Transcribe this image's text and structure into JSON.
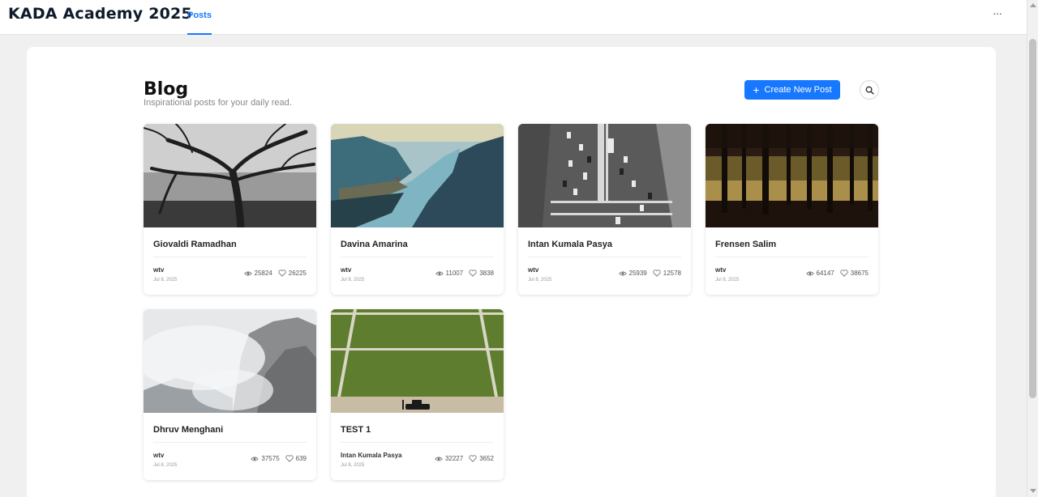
{
  "header": {
    "brand": "KADA Academy 2025",
    "tab_posts": "Posts",
    "more": "···"
  },
  "page": {
    "title": "Blog",
    "subtitle": "Inspirational posts for your daily read.",
    "create_button": "Create New Post"
  },
  "colors": {
    "accent": "#1677ff"
  },
  "cards": [
    {
      "author": "Giovaldi Ramadhan",
      "category": "wtv",
      "date": "Jul 8, 2025",
      "views": "25824",
      "likes": "26225",
      "image": "bare-tree-bw"
    },
    {
      "author": "Davina Amarina",
      "category": "wtv",
      "date": "Jul 8, 2025",
      "views": "11007",
      "likes": "3838",
      "image": "fjord-cliff"
    },
    {
      "author": "Intan Kumala Pasya",
      "category": "wtv",
      "date": "Jul 8, 2025",
      "views": "25939",
      "likes": "12578",
      "image": "city-road-traffic"
    },
    {
      "author": "Frensen Salim",
      "category": "wtv",
      "date": "Jul 8, 2025",
      "views": "64147",
      "likes": "38675",
      "image": "dark-forest"
    },
    {
      "author": "Dhruv Menghani",
      "category": "wtv",
      "date": "Jul 8, 2025",
      "views": "37575",
      "likes": "639",
      "image": "misty-mountain"
    },
    {
      "author": "TEST 1",
      "category": "Intan Kumala Pasya",
      "date": "Jul 8, 2025",
      "views": "32227",
      "likes": "3652",
      "image": "green-lawn-car"
    }
  ]
}
